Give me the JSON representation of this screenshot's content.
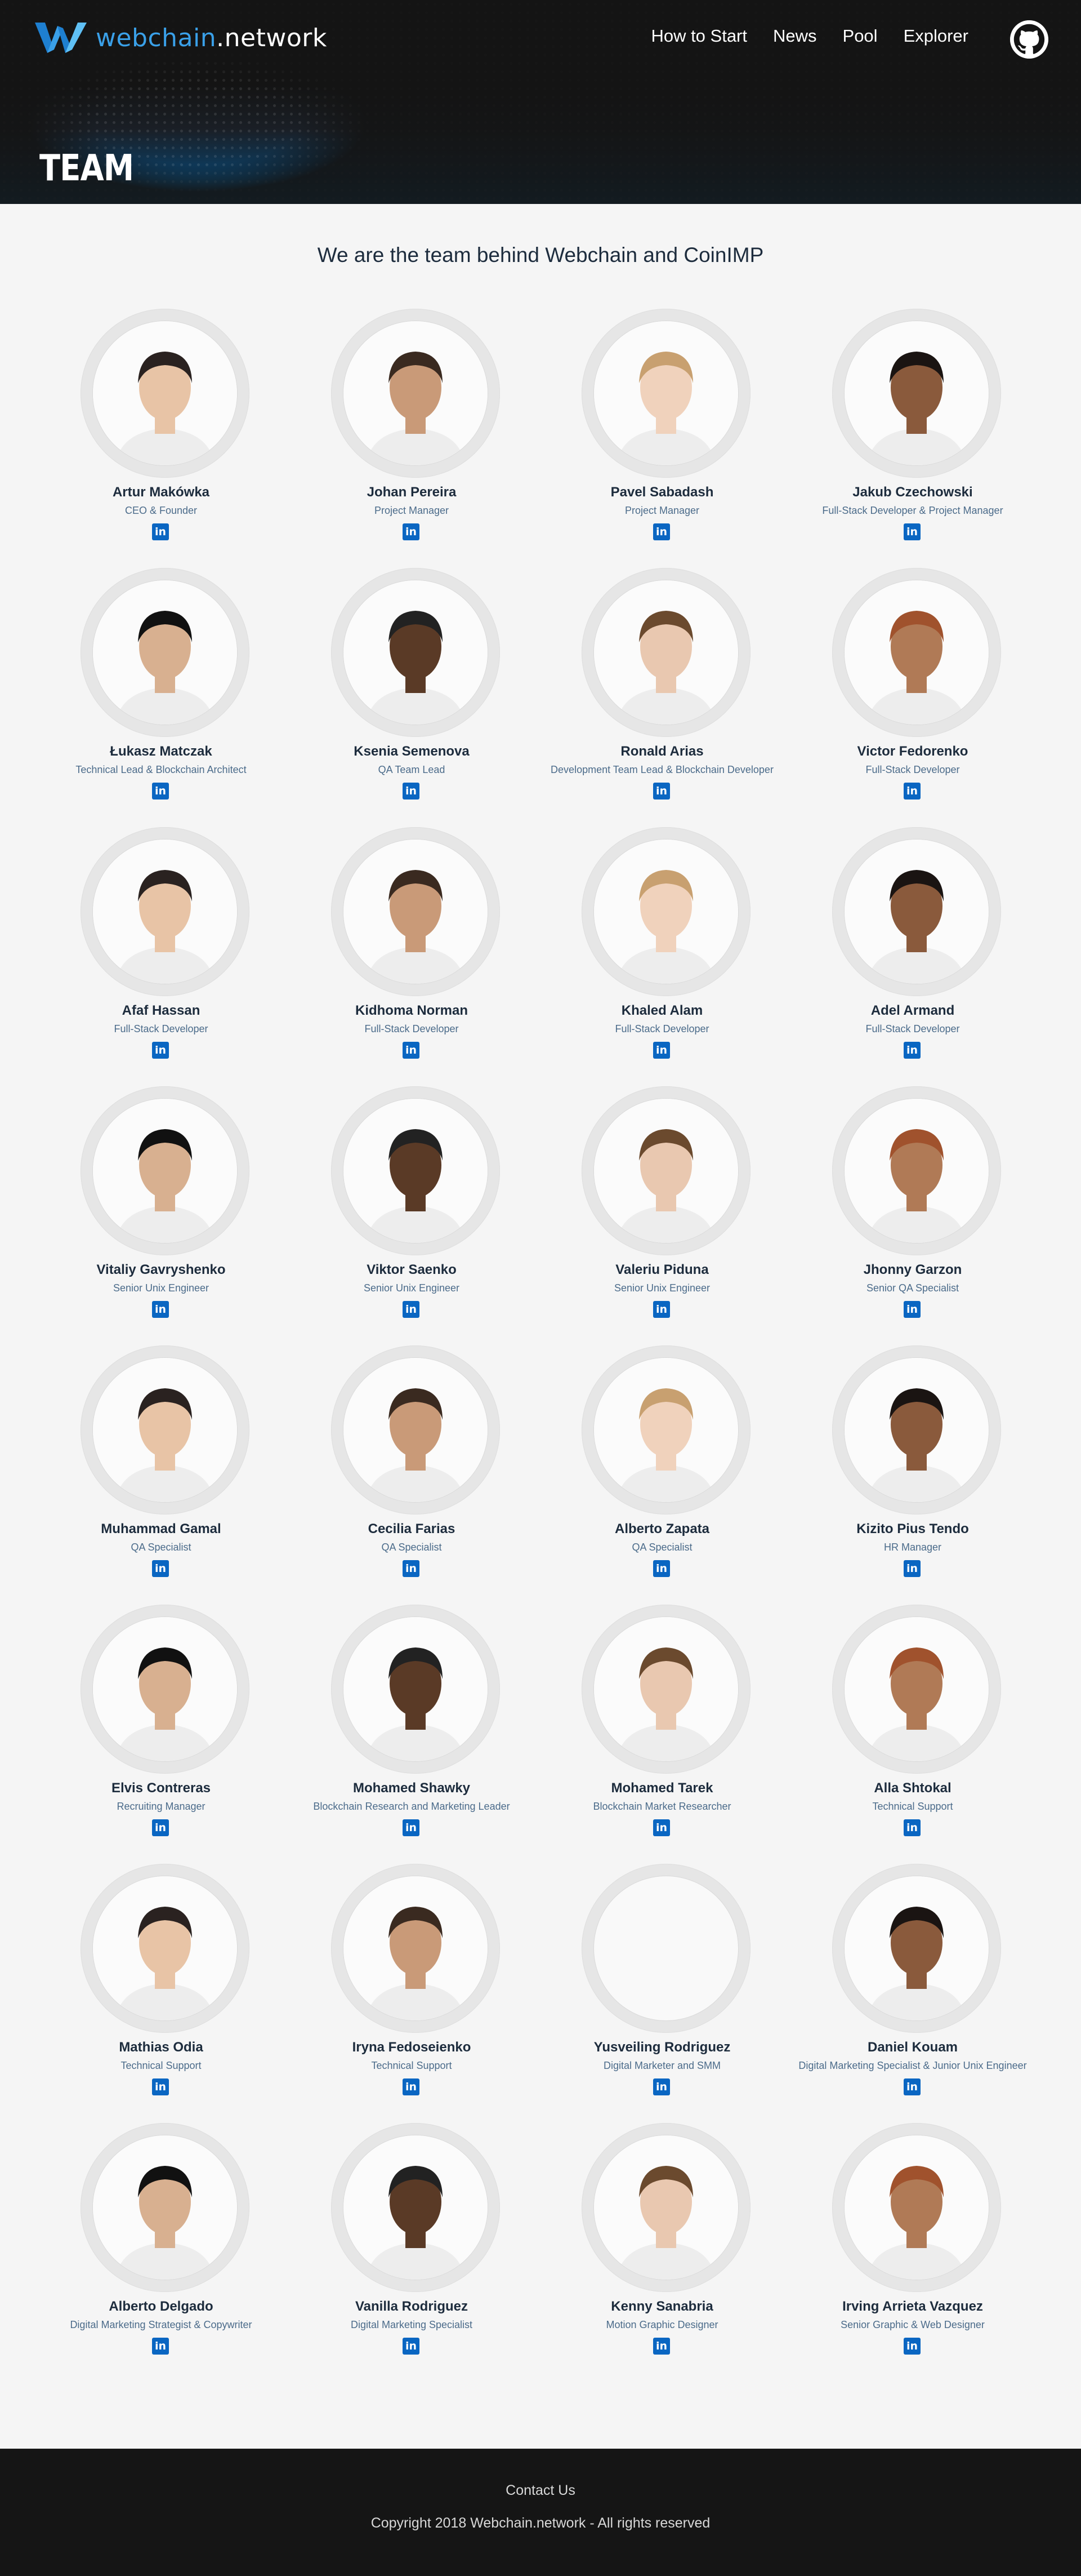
{
  "brand": {
    "name_prefix": "webchain",
    "name_suffix": ".network",
    "accent": "#3aa0e8"
  },
  "nav": {
    "items": [
      "How to Start",
      "News",
      "Pool",
      "Explorer"
    ],
    "github_icon": "github-icon"
  },
  "page": {
    "title": "TEAM",
    "headline": "We are the team behind Webchain and CoinIMP"
  },
  "team": [
    {
      "name": "Artur Makówka",
      "role": "CEO & Founder"
    },
    {
      "name": "Johan Pereira",
      "role": "Project Manager"
    },
    {
      "name": "Pavel Sabadash",
      "role": "Project Manager"
    },
    {
      "name": "Jakub Czechowski",
      "role": "Full-Stack Developer & Project Manager"
    },
    {
      "name": "Łukasz Matczak",
      "role": "Technical Lead & Blockchain Architect"
    },
    {
      "name": "Ksenia Semenova",
      "role": "QA Team Lead"
    },
    {
      "name": "Ronald Arias",
      "role": "Development Team Lead & Blockchain Developer"
    },
    {
      "name": "Victor Fedorenko",
      "role": "Full-Stack Developer"
    },
    {
      "name": "Afaf Hassan",
      "role": "Full-Stack Developer"
    },
    {
      "name": "Kidhoma Norman",
      "role": "Full-Stack Developer"
    },
    {
      "name": "Khaled Alam",
      "role": "Full-Stack Developer"
    },
    {
      "name": "Adel Armand",
      "role": "Full-Stack Developer"
    },
    {
      "name": "Vitaliy Gavryshenko",
      "role": "Senior Unix Engineer"
    },
    {
      "name": "Viktor Saenko",
      "role": "Senior Unix Engineer"
    },
    {
      "name": "Valeriu Piduna",
      "role": "Senior Unix Engineer"
    },
    {
      "name": "Jhonny Garzon",
      "role": "Senior QA Specialist"
    },
    {
      "name": "Muhammad Gamal",
      "role": "QA Specialist"
    },
    {
      "name": "Cecilia Farias",
      "role": "QA Specialist"
    },
    {
      "name": "Alberto Zapata",
      "role": "QA Specialist"
    },
    {
      "name": "Kizito Pius Tendo",
      "role": "HR Manager"
    },
    {
      "name": "Elvis Contreras",
      "role": "Recruiting Manager"
    },
    {
      "name": "Mohamed Shawky",
      "role": "Blockchain Research and Marketing Leader"
    },
    {
      "name": "Mohamed Tarek",
      "role": "Blockchain Market Researcher"
    },
    {
      "name": "Alla Shtokal",
      "role": "Technical Support"
    },
    {
      "name": "Mathias Odia",
      "role": "Technical Support"
    },
    {
      "name": "Iryna Fedoseienko",
      "role": "Technical Support"
    },
    {
      "name": "Yusveiling Rodriguez",
      "role": "Digital Marketer and SMM"
    },
    {
      "name": "Daniel Kouam",
      "role": "Digital Marketing Specialist & Junior Unix Engineer"
    },
    {
      "name": "Alberto Delgado",
      "role": "Digital Marketing Strategist & Copywriter"
    },
    {
      "name": "Vanilla Rodriguez",
      "role": "Digital Marketing Specialist"
    },
    {
      "name": "Kenny Sanabria",
      "role": "Motion Graphic Designer"
    },
    {
      "name": "Irving Arrieta Vazquez",
      "role": "Senior Graphic & Web Designer"
    }
  ],
  "footer": {
    "contact": "Contact Us",
    "copyright": "Copyright 2018 Webchain.network - All rights reserved"
  }
}
